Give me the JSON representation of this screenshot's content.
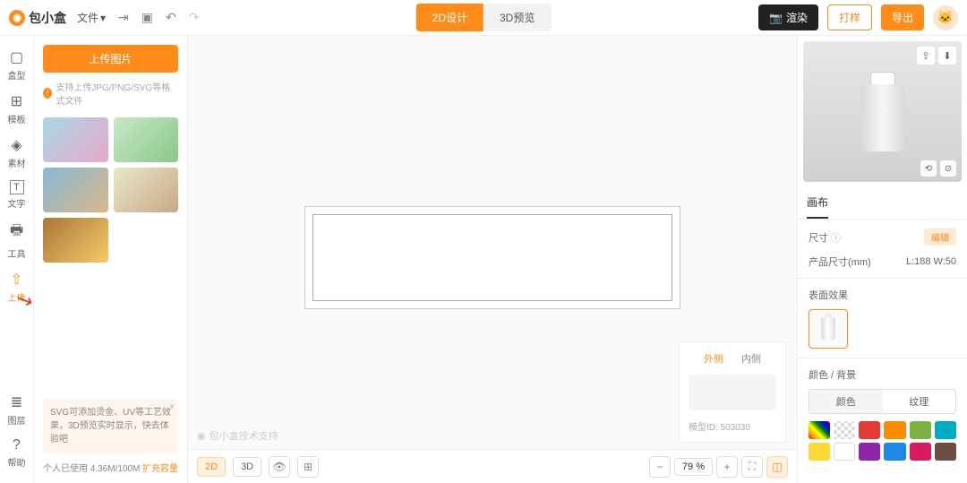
{
  "topbar": {
    "brand": "包小盒",
    "file_menu": "文件",
    "tabs": {
      "design2d": "2D设计",
      "preview3d": "3D预览"
    },
    "render": "渲染",
    "sample": "打样",
    "export": "导出"
  },
  "sidebar": {
    "items": [
      {
        "icon": "▢",
        "label": "盒型"
      },
      {
        "icon": "⊞",
        "label": "模板"
      },
      {
        "icon": "◈",
        "label": "素材"
      },
      {
        "icon": "T",
        "label": "文字"
      },
      {
        "icon": "⚒",
        "label": "工具"
      },
      {
        "icon": "⇧",
        "label": "上传"
      }
    ],
    "bottom": [
      {
        "icon": "≣",
        "label": "图层"
      },
      {
        "icon": "?",
        "label": "帮助"
      }
    ]
  },
  "panel": {
    "upload_btn": "上传图片",
    "hint": "支持上传JPG/PNG/SVG等格式文件",
    "tip": "SVG可添加烫金、UV等工艺效果，3D预览实时显示，快去体验吧",
    "storage": "个人已使用 4.36M/100M",
    "expand": "扩充容量"
  },
  "canvas": {
    "watermark": "包小盒技术支持",
    "sides": {
      "outer": "外侧",
      "inner": "内侧"
    },
    "model_id_label": "模型ID:",
    "model_id": "503030",
    "bottom": {
      "btn2d": "2D",
      "btn3d": "3D"
    },
    "zoom": "79 %"
  },
  "rightpanel": {
    "tab_canvas": "画布",
    "size_label": "尺寸",
    "edit": "编辑",
    "product_size_label": "产品尺寸(mm)",
    "product_size_value": "L:188  W:50",
    "surface_effect": "表面效果",
    "color_bg": "颜色 / 背景",
    "color_tab": "颜色",
    "texture_tab": "纹理",
    "swatches": [
      "linear-gradient(45deg,red,orange,yellow,green,blue,purple)",
      "repeating-conic-gradient(#ddd 0 25%,#fff 0 50%) 50%/8px 8px",
      "#e53935",
      "#fb8c00",
      "#7cb342",
      "#00acc1",
      "#fdd835",
      "#fff",
      "#8e24aa",
      "#1e88e5",
      "#d81b60",
      "#6d4c41"
    ]
  }
}
